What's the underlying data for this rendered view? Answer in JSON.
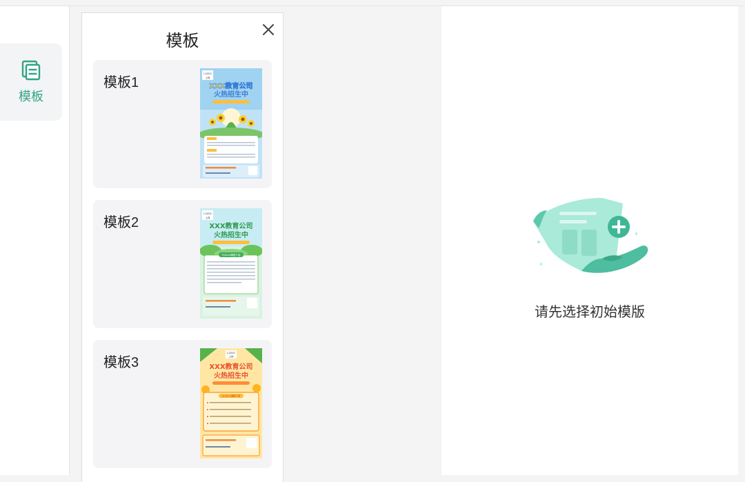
{
  "sidebar": {
    "template_tool": {
      "label": "模板",
      "icon": "template-icon"
    }
  },
  "panel": {
    "title": "模板",
    "close_icon": "close-icon",
    "templates": [
      {
        "name": "模板1",
        "preview": {
          "logo": "LOGO",
          "logo_sub": "上传",
          "headline": "XXX教育公司",
          "subheadline": "火热招生中",
          "theme": "blue-sunflower"
        }
      },
      {
        "name": "模板2",
        "preview": {
          "logo": "LOGO",
          "logo_sub": "上传",
          "headline": "XXX教育公司",
          "subheadline": "火热招生中",
          "banner": "Python课程介绍",
          "theme": "green-forest"
        }
      },
      {
        "name": "模板3",
        "preview": {
          "logo": "LOGO",
          "logo_sub": "上传",
          "headline": "XXX教育公司",
          "subheadline": "火热招生中",
          "banner": "Scratch课程介绍",
          "theme": "orange-fruit"
        }
      }
    ]
  },
  "canvas": {
    "empty_message": "请先选择初始模版",
    "illustration": "scroll-add-icon"
  },
  "colors": {
    "accent": "#33a387",
    "illustration_light": "#a9ead8",
    "illustration_dark": "#5cc9ad"
  }
}
